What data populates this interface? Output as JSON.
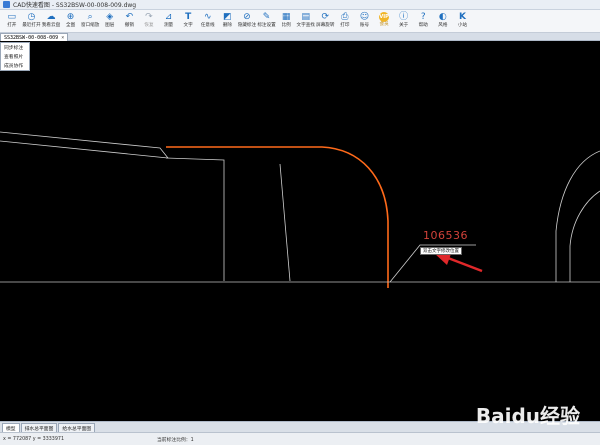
{
  "window": {
    "title": "CAD快速看图 - SS32BSW-00-008-009.dwg"
  },
  "toolbar": {
    "items": [
      {
        "label": "打开",
        "icon": "folder-icon"
      },
      {
        "label": "最近打开",
        "icon": "history-icon"
      },
      {
        "label": "我看云盘",
        "icon": "cloud-icon"
      },
      {
        "label": "全图",
        "icon": "full-extent-icon"
      },
      {
        "label": "窗口缩放",
        "icon": "window-zoom-icon"
      },
      {
        "label": "图层",
        "icon": "layers-icon"
      },
      {
        "label": "撤销",
        "icon": "undo-icon"
      },
      {
        "label": "恢复",
        "icon": "redo-icon"
      },
      {
        "label": "测量",
        "icon": "measure-icon"
      },
      {
        "label": "文字",
        "icon": "text-icon"
      },
      {
        "label": "任意线",
        "icon": "freeline-icon"
      },
      {
        "label": "删除",
        "icon": "eraser-icon"
      },
      {
        "label": "隐藏标注",
        "icon": "hide-annotation-icon"
      },
      {
        "label": "标注设置",
        "icon": "annotation-settings-icon"
      },
      {
        "label": "比例",
        "icon": "scale-icon"
      },
      {
        "label": "文字查找",
        "icon": "text-search-icon"
      },
      {
        "label": "屏幕旋转",
        "icon": "rotate-screen-icon"
      },
      {
        "label": "打印",
        "icon": "print-icon"
      },
      {
        "label": "账号",
        "icon": "account-icon"
      },
      {
        "label": "会员",
        "icon": "vip-icon"
      },
      {
        "label": "关于",
        "icon": "about-icon"
      },
      {
        "label": "帮助",
        "icon": "help-icon"
      },
      {
        "label": "风格",
        "icon": "style-icon"
      },
      {
        "label": "小站",
        "icon": "station-icon"
      }
    ],
    "vip_badge": "VIP"
  },
  "doc_tab": {
    "name": "SS32BSW-00-008-009",
    "close": "×"
  },
  "context_menu": {
    "items": [
      "同步标注",
      "查看照片",
      "成员协作"
    ]
  },
  "canvas": {
    "dimension_text": "106536",
    "tooltip": "双击文字修改位置"
  },
  "layout_tabs": [
    "模型",
    "排水总平面图",
    "给水总平面图"
  ],
  "status": {
    "coords": "x = 772087  y = 3333971",
    "scale": "当前标注比例：1"
  },
  "watermark": "Baidu经验",
  "colors": {
    "canvas_bg": "#000000",
    "line_gray": "#cfcfcf",
    "highlight": "#ff6a1a",
    "dimension": "#d2423a",
    "arrow": "#e0282a"
  }
}
